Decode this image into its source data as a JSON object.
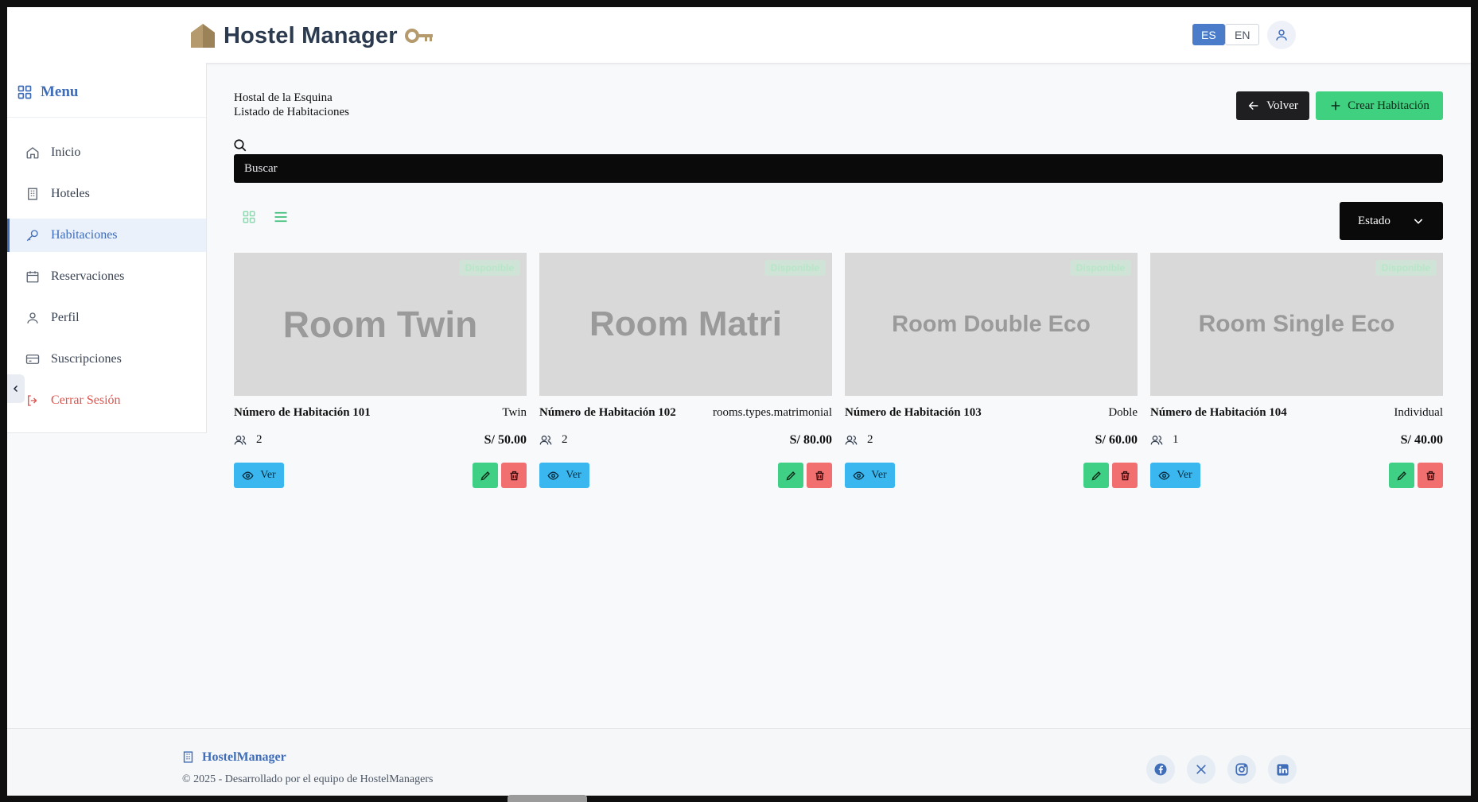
{
  "header": {
    "app_title": "Hostel Manager",
    "lang_es": "ES",
    "lang_en": "EN"
  },
  "sidebar": {
    "title": "Menu",
    "items": [
      {
        "label": "Inicio",
        "icon": "home-icon"
      },
      {
        "label": "Hoteles",
        "icon": "building-icon"
      },
      {
        "label": "Habitaciones",
        "icon": "key-icon"
      },
      {
        "label": "Reservaciones",
        "icon": "calendar-icon"
      },
      {
        "label": "Perfil",
        "icon": "user-icon"
      },
      {
        "label": "Suscripciones",
        "icon": "credit-card-icon"
      },
      {
        "label": "Cerrar Sesión",
        "icon": "logout-icon"
      }
    ],
    "active": "Habitaciones"
  },
  "main": {
    "hostel_name": "Hostal de la Esquina",
    "subtitle": "Listado de Habitaciones",
    "back_label": "Volver",
    "create_label": "Crear Habitación",
    "search_placeholder": "Buscar",
    "filter_label": "Estado"
  },
  "rooms": [
    {
      "image_text": "Room Twin",
      "badge": "Disponible",
      "number": "Número de Habitación 101",
      "type": "Twin",
      "capacity": "2",
      "price": "S/ 50.00",
      "view_label": "Ver"
    },
    {
      "image_text": "Room Matri",
      "badge": "Disponible",
      "number": "Número de Habitación 102",
      "type": "rooms.types.matrimonial",
      "capacity": "2",
      "price": "S/ 80.00",
      "view_label": "Ver"
    },
    {
      "image_text": "Room Double Eco",
      "badge": "Disponible",
      "number": "Número de Habitación 103",
      "type": "Doble",
      "capacity": "2",
      "price": "S/ 60.00",
      "view_label": "Ver"
    },
    {
      "image_text": "Room Single Eco",
      "badge": "Disponible",
      "number": "Número de Habitación 104",
      "type": "Individual",
      "capacity": "1",
      "price": "S/ 40.00",
      "view_label": "Ver"
    }
  ],
  "footer": {
    "brand": "HostelManager",
    "copyright": "© 2025 - Desarrollado por el equipo de HostelManagers",
    "social": [
      "facebook-icon",
      "x-icon",
      "instagram-icon",
      "linkedin-icon"
    ]
  },
  "colors": {
    "brand_blue": "#3f6db8",
    "create_green": "#3fd080",
    "view_blue": "#3ab7ef",
    "delete_red": "#f16f6f",
    "logout_red": "#e0524b"
  }
}
